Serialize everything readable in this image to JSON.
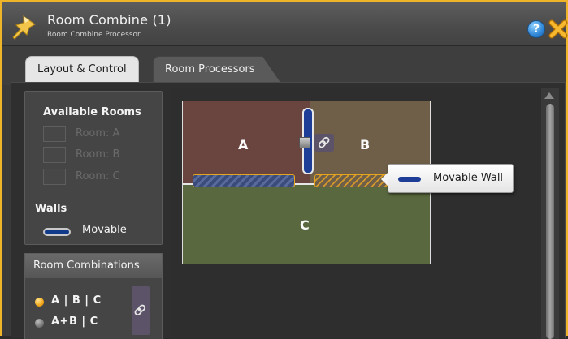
{
  "window": {
    "title": "Room Combine (1)",
    "subtitle": "Room Combine Processor",
    "icons": {
      "app": "pushpin-icon",
      "help": "help-icon",
      "close": "close-icon"
    },
    "help_glyph": "?"
  },
  "tabs": [
    {
      "label": "Layout & Control",
      "active": true
    },
    {
      "label": "Room Processors",
      "active": false
    }
  ],
  "sidebar": {
    "available_rooms_heading": "Available Rooms",
    "rooms": [
      {
        "label": "Room: A"
      },
      {
        "label": "Room: B"
      },
      {
        "label": "Room: C"
      }
    ],
    "walls_heading": "Walls",
    "wall_legend": {
      "label": "Movable"
    }
  },
  "combinations": {
    "heading": "Room Combinations",
    "items": [
      {
        "label": "A | B | C",
        "selected": true
      },
      {
        "label": "A+B | C",
        "selected": false
      }
    ],
    "link_icon": "link-icon"
  },
  "layout": {
    "rooms": [
      {
        "letter": "A"
      },
      {
        "letter": "B"
      },
      {
        "letter": "C"
      }
    ],
    "tooltip": {
      "label": "Movable Wall"
    },
    "link_icon": "link-icon"
  },
  "colors": {
    "window_border": "#f0b429",
    "room_a": "#6a4540",
    "room_b": "#6f5f48",
    "room_c": "#59683f",
    "movable_wall": "#1d3d97",
    "wall_outline": "#e6a41e"
  }
}
